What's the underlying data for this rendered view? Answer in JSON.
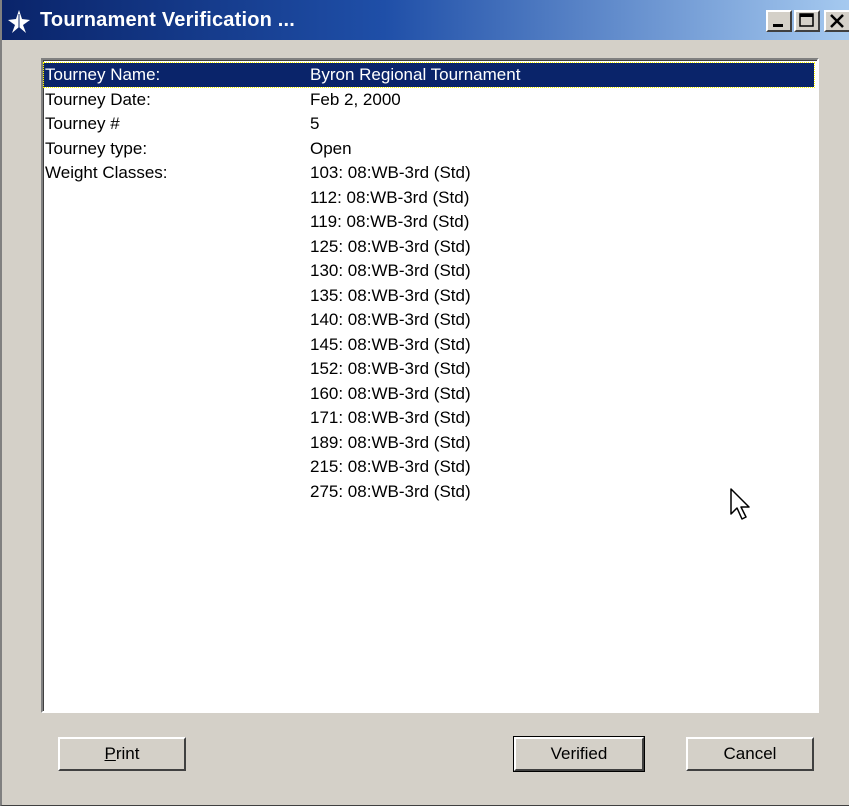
{
  "window": {
    "title": "Tournament Verification ...",
    "controls": {
      "minimize": "minimize",
      "maximize": "maximize",
      "close": "close"
    }
  },
  "info": {
    "rows": [
      {
        "label": "Tourney Name:",
        "value": "Byron Regional Tournament",
        "selected": true
      },
      {
        "label": "Tourney Date:",
        "value": "Feb 2, 2000"
      },
      {
        "label": "Tourney #",
        "value": "5"
      },
      {
        "label": "Tourney type:",
        "value": "Open"
      },
      {
        "label": "Weight Classes:",
        "value": "103: 08:WB-3rd (Std)"
      },
      {
        "label": "",
        "value": "112: 08:WB-3rd (Std)"
      },
      {
        "label": "",
        "value": "119: 08:WB-3rd (Std)"
      },
      {
        "label": "",
        "value": "125: 08:WB-3rd (Std)"
      },
      {
        "label": "",
        "value": "130: 08:WB-3rd (Std)"
      },
      {
        "label": "",
        "value": "135: 08:WB-3rd (Std)"
      },
      {
        "label": "",
        "value": "140: 08:WB-3rd (Std)"
      },
      {
        "label": "",
        "value": "145: 08:WB-3rd (Std)"
      },
      {
        "label": "",
        "value": "152: 08:WB-3rd (Std)"
      },
      {
        "label": "",
        "value": "160: 08:WB-3rd (Std)"
      },
      {
        "label": "",
        "value": "171: 08:WB-3rd (Std)"
      },
      {
        "label": "",
        "value": "189: 08:WB-3rd (Std)"
      },
      {
        "label": "",
        "value": "215: 08:WB-3rd (Std)"
      },
      {
        "label": "",
        "value": "275: 08:WB-3rd (Std)"
      }
    ]
  },
  "buttons": {
    "print_first": "P",
    "print_rest": "rint",
    "verified": "Verified",
    "cancel": "Cancel"
  },
  "colors": {
    "titlebar_start": "#0a246a",
    "titlebar_end": "#a6caf0",
    "selection": "#0a246a",
    "face": "#d4d0c8"
  },
  "icons": {
    "app": "star-app-icon",
    "cursor": "mouse-pointer-icon"
  }
}
